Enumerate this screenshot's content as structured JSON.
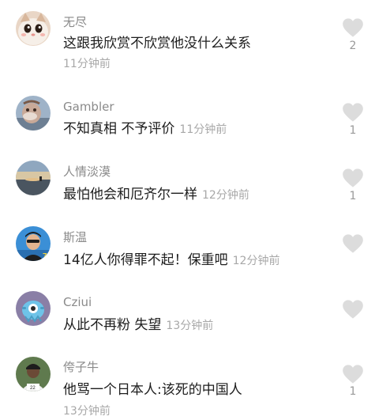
{
  "comments": [
    {
      "username": "无尽",
      "text": "这跟我欣赏不欣赏他没什么关系",
      "time": "11分钟前",
      "likes": "2",
      "avatar": "cat-avatar-icon"
    },
    {
      "username": "Gambler",
      "text": "不知真相 不予评价",
      "time": "11分钟前",
      "likes": "1",
      "avatar": "cartoon-avatar-icon"
    },
    {
      "username": "人情淡漠",
      "text": "最怕他会和厄齐尔一样",
      "time": "12分钟前",
      "likes": "1",
      "avatar": "sunset-avatar-icon"
    },
    {
      "username": "斯温",
      "text": "14亿人你得罪不起！保重吧",
      "time": "12分钟前",
      "likes": "",
      "avatar": "person-avatar-icon"
    },
    {
      "username": "Cziui",
      "text": "从此不再粉 失望",
      "time": "13分钟前",
      "likes": "",
      "avatar": "monster-avatar-icon"
    },
    {
      "username": "侉子牛",
      "text": "他骂一个日本人:该死的中国人",
      "time": "13分钟前",
      "likes": "1",
      "avatar": "player-avatar-icon"
    }
  ],
  "colors": {
    "username": "#8a8a8a",
    "text": "#1d1d1d",
    "time": "#a8a8a8",
    "heart": "#dcdcdc"
  }
}
